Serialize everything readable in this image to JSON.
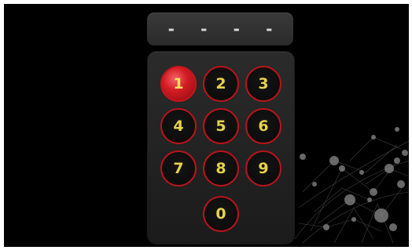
{
  "code_display": {
    "slots": [
      "-",
      "-",
      "-",
      "-"
    ]
  },
  "keypad": {
    "keys": [
      {
        "label": "1",
        "active": true
      },
      {
        "label": "2",
        "active": false
      },
      {
        "label": "3",
        "active": false
      },
      {
        "label": "4",
        "active": false
      },
      {
        "label": "5",
        "active": false
      },
      {
        "label": "6",
        "active": false
      },
      {
        "label": "7",
        "active": false
      },
      {
        "label": "8",
        "active": false
      },
      {
        "label": "9",
        "active": false
      },
      {
        "label": "0",
        "active": false
      }
    ]
  },
  "colors": {
    "key_border": "#b7141c",
    "key_text": "#e8d24a",
    "active_key": "#d41c24",
    "background": "#000000"
  }
}
